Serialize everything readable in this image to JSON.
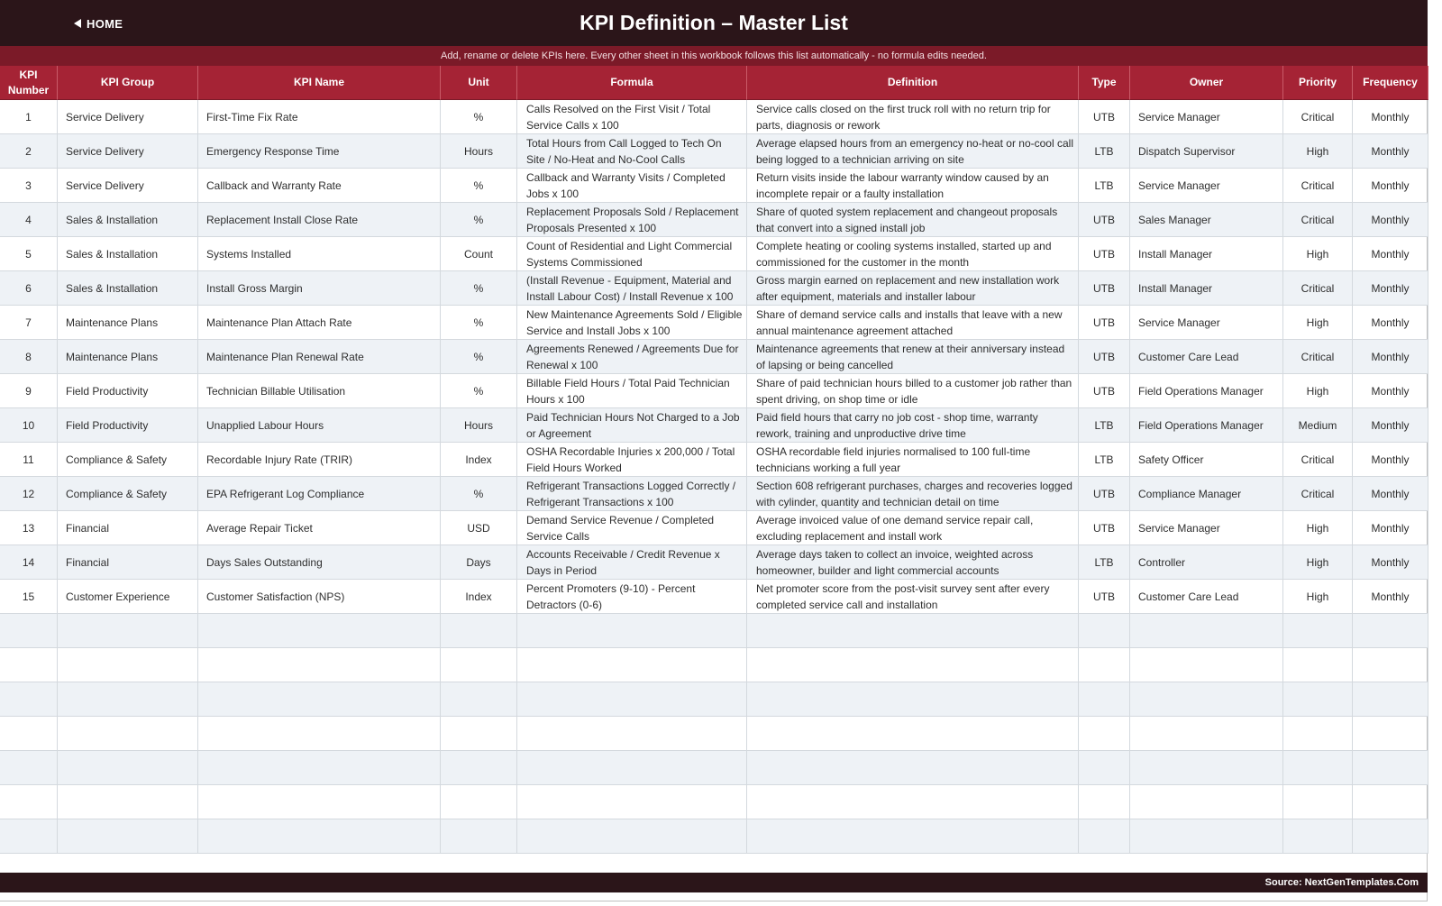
{
  "header": {
    "home_label": "HOME",
    "title": "KPI Definition  –  Master List",
    "subtitle": "Add, rename or delete KPIs here. Every other sheet in this workbook follows this list automatically - no formula edits needed."
  },
  "columns": [
    "KPI Number",
    "KPI Group",
    "KPI Name",
    "Unit",
    "Formula",
    "Definition",
    "Type",
    "Owner",
    "Priority",
    "Frequency"
  ],
  "rows": [
    [
      "1",
      "Service Delivery",
      "First-Time Fix Rate",
      "%",
      "Calls Resolved on the First Visit / Total Service Calls x 100",
      "Service calls closed on the first truck roll with no return trip for parts, diagnosis or rework",
      "UTB",
      "Service Manager",
      "Critical",
      "Monthly"
    ],
    [
      "2",
      "Service Delivery",
      "Emergency Response Time",
      "Hours",
      "Total Hours from Call Logged to Tech On Site / No-Heat and No-Cool Calls",
      "Average elapsed hours from an emergency no-heat or no-cool call being logged to a technician arriving on site",
      "LTB",
      "Dispatch Supervisor",
      "High",
      "Monthly"
    ],
    [
      "3",
      "Service Delivery",
      "Callback and Warranty Rate",
      "%",
      "Callback and Warranty Visits / Completed Jobs x 100",
      "Return visits inside the labour warranty window caused by an incomplete repair or a faulty installation",
      "LTB",
      "Service Manager",
      "Critical",
      "Monthly"
    ],
    [
      "4",
      "Sales & Installation",
      "Replacement Install Close Rate",
      "%",
      "Replacement Proposals Sold / Replacement Proposals Presented x 100",
      "Share of quoted system replacement and changeout proposals that convert into a signed install job",
      "UTB",
      "Sales Manager",
      "Critical",
      "Monthly"
    ],
    [
      "5",
      "Sales & Installation",
      "Systems Installed",
      "Count",
      "Count of Residential and Light Commercial Systems Commissioned",
      "Complete heating or cooling systems installed, started up and commissioned for the customer in the month",
      "UTB",
      "Install Manager",
      "High",
      "Monthly"
    ],
    [
      "6",
      "Sales & Installation",
      "Install Gross Margin",
      "%",
      "(Install Revenue - Equipment, Material and Install Labour Cost) / Install Revenue x 100",
      "Gross margin earned on replacement and new installation work after equipment, materials and installer labour",
      "UTB",
      "Install Manager",
      "Critical",
      "Monthly"
    ],
    [
      "7",
      "Maintenance Plans",
      "Maintenance Plan Attach Rate",
      "%",
      "New Maintenance Agreements Sold / Eligible Service and Install Jobs x 100",
      "Share of demand service calls and installs that leave with a new annual maintenance agreement attached",
      "UTB",
      "Service Manager",
      "High",
      "Monthly"
    ],
    [
      "8",
      "Maintenance Plans",
      "Maintenance Plan Renewal Rate",
      "%",
      "Agreements Renewed / Agreements Due for Renewal x 100",
      "Maintenance agreements that renew at their anniversary instead of lapsing or being cancelled",
      "UTB",
      "Customer Care Lead",
      "Critical",
      "Monthly"
    ],
    [
      "9",
      "Field Productivity",
      "Technician Billable Utilisation",
      "%",
      "Billable Field Hours / Total Paid Technician Hours x 100",
      "Share of paid technician hours billed to a customer job rather than spent driving, on shop time or idle",
      "UTB",
      "Field Operations Manager",
      "High",
      "Monthly"
    ],
    [
      "10",
      "Field Productivity",
      "Unapplied Labour Hours",
      "Hours",
      "Paid Technician Hours Not Charged to a Job or Agreement",
      "Paid field hours that carry no job cost - shop time, warranty rework, training and unproductive drive time",
      "LTB",
      "Field Operations Manager",
      "Medium",
      "Monthly"
    ],
    [
      "11",
      "Compliance & Safety",
      "Recordable Injury Rate (TRIR)",
      "Index",
      "OSHA Recordable Injuries x 200,000 / Total Field Hours Worked",
      "OSHA recordable field injuries normalised to 100 full-time technicians working a full year",
      "LTB",
      "Safety Officer",
      "Critical",
      "Monthly"
    ],
    [
      "12",
      "Compliance & Safety",
      "EPA Refrigerant Log Compliance",
      "%",
      "Refrigerant Transactions Logged Correctly / Refrigerant Transactions x 100",
      "Section 608 refrigerant purchases, charges and recoveries logged with cylinder, quantity and technician detail on time",
      "UTB",
      "Compliance Manager",
      "Critical",
      "Monthly"
    ],
    [
      "13",
      "Financial",
      "Average Repair Ticket",
      "USD",
      "Demand Service Revenue / Completed Service Calls",
      "Average invoiced value of one demand service repair call, excluding replacement and install work",
      "UTB",
      "Service Manager",
      "High",
      "Monthly"
    ],
    [
      "14",
      "Financial",
      "Days Sales Outstanding",
      "Days",
      "Accounts Receivable / Credit Revenue x Days in Period",
      "Average days taken to collect an invoice, weighted across homeowner, builder and light commercial accounts",
      "LTB",
      "Controller",
      "High",
      "Monthly"
    ],
    [
      "15",
      "Customer Experience",
      "Customer Satisfaction (NPS)",
      "Index",
      "Percent Promoters (9-10) - Percent Detractors (0-6)",
      "Net promoter score from the post-visit survey sent after every completed service call and installation",
      "UTB",
      "Customer Care Lead",
      "High",
      "Monthly"
    ]
  ],
  "footer": {
    "source": "Source: NextGenTemplates.Com"
  },
  "colors": {
    "title_bg": "#2b1519",
    "subtitle_bg": "#7b1a28",
    "header_bg": "#a52335",
    "alt_row_bg": "#eef2f6"
  }
}
